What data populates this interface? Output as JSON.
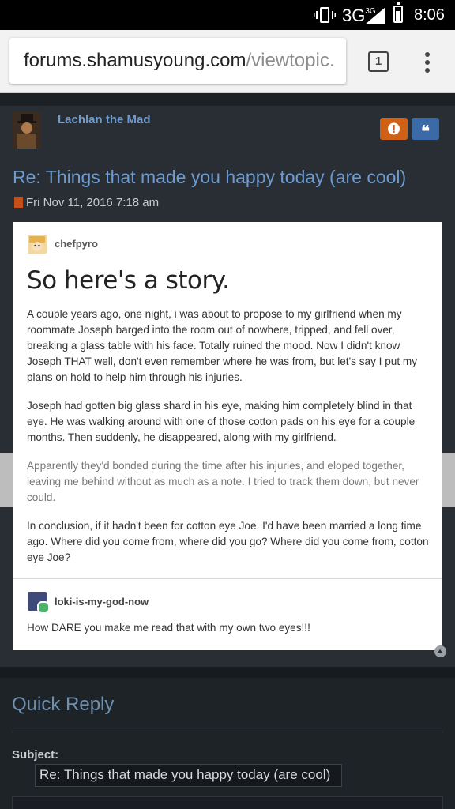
{
  "status_bar": {
    "network": "3G",
    "network_sup": "3G",
    "time": "8:06"
  },
  "browser": {
    "url_host": "forums.shamusyoung.com",
    "url_path": "/viewtopic.",
    "tab_count": "1"
  },
  "post": {
    "author": "Lachlan the Mad",
    "quote_icon_glyph": "❝",
    "title": "Re: Things that made you happy today (are cool)",
    "date": "Fri Nov 11, 2016 7:18 am"
  },
  "tumblr": {
    "op_user": "chefpyro",
    "story_title": "So here's a story.",
    "paragraphs": [
      "A couple years ago, one night, i was about to propose to my girlfriend when my roommate Joseph barged into the room out of nowhere, tripped, and fell over, breaking a glass table with his face. Totally ruined the mood. Now I didn't know Joseph THAT well, don't even remember where he was from, but let's say I put my plans on hold to help him through his injuries.",
      "Joseph had gotten big glass shard in his eye, making him completely blind in that eye. He was walking around with one of those cotton pads on his eye for a couple months. Then suddenly, he disappeared, along with my girlfriend.",
      "Apparently they'd bonded during the time after his injuries, and eloped together, leaving me behind without as much as a note. I tried to track them down, but never could.",
      "In conclusion, if it hadn't been for cotton eye Joe, I'd have been married a long time ago. Where did you come from, where did you go? Where did you come from, cotton eye Joe?"
    ],
    "reply_user": "loki-is-my-god-now",
    "reply_text": "How DARE you make me read that with my own two eyes!!!"
  },
  "quick_reply": {
    "title": "Quick Reply",
    "subject_label": "Subject:",
    "subject_value": "Re: Things that made you happy today (are cool)"
  },
  "colors": {
    "link_blue": "#6e9bd0",
    "report_orange": "#cf6117",
    "quote_blue": "#3b6aa8"
  }
}
